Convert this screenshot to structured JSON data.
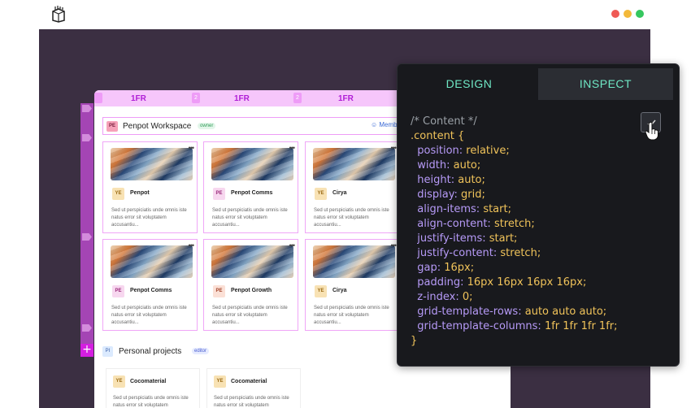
{
  "window": {
    "logo_icon": "box-logo-icon",
    "dots": [
      "#ef5a55",
      "#f3b93a",
      "#36c75f"
    ]
  },
  "colruler": {
    "tracks": [
      "1FR",
      "1FR",
      "1FR"
    ],
    "gaps": [
      "2",
      "2",
      "2"
    ]
  },
  "workspace": {
    "badge": "PE",
    "title": "Penpot Workspace",
    "role": "owner",
    "members_label": "Memb"
  },
  "projects": [
    {
      "badge": "YE",
      "badge_bg": "#f8e2b4",
      "badge_color": "#9a6a14",
      "name": "Penpot",
      "desc": "Sed ut perspiciatis unde omnis iste natus error sit voluptatem accusantiu..."
    },
    {
      "badge": "PE",
      "badge_bg": "#f7d7ef",
      "badge_color": "#9b2c7c",
      "name": "Penpot Comms",
      "desc": "Sed ut perspiciatis unde omnis iste natus error sit voluptatem accusantiu..."
    },
    {
      "badge": "YE",
      "badge_bg": "#f8e2b4",
      "badge_color": "#9a6a14",
      "name": "Cirya",
      "desc": "Sed ut perspiciatis unde omnis iste natus error sit voluptatem accusantiu..."
    },
    {
      "badge": "PE",
      "badge_bg": "#f7d7ef",
      "badge_color": "#9b2c7c",
      "name": "Penpot Comms",
      "desc": "Sed ut perspiciatis unde omnis iste natus error sit voluptatem accusantiu..."
    },
    {
      "badge": "PE",
      "badge_bg": "#fbe0d6",
      "badge_color": "#a2452b",
      "name": "Penpot Growth",
      "desc": "Sed ut perspiciatis unde omnis iste natus error sit voluptatem accusantiu..."
    },
    {
      "badge": "YE",
      "badge_bg": "#f8e2b4",
      "badge_color": "#9a6a14",
      "name": "Cirya",
      "desc": "Sed ut perspiciatis unde omnis iste natus error sit voluptatem accusantiu..."
    }
  ],
  "personal": {
    "badge": "PI",
    "title": "Personal projects",
    "role": "editor",
    "cards": [
      {
        "badge": "YE",
        "name": "Cocomaterial",
        "desc": "Sed ut perspiciatis unde omnis iste natus error sit voluptatem"
      },
      {
        "badge": "YE",
        "name": "Cocomaterial",
        "desc": "Sed ut perspiciatis unde omnis iste natus error sit voluptatem"
      }
    ]
  },
  "inspect": {
    "tabs": [
      "DESIGN",
      "INSPECT"
    ],
    "active_tab": "INSPECT",
    "code": {
      "comment": "/* Content */",
      "selector": ".content {",
      "declarations": [
        {
          "prop": "position:",
          "val": "relative;"
        },
        {
          "prop": "width:",
          "val": "auto;"
        },
        {
          "prop": "height:",
          "val": "auto;"
        },
        {
          "prop": "display:",
          "val": "grid;"
        },
        {
          "prop": "align-items:",
          "val": "start;"
        },
        {
          "prop": "align-content:",
          "val": "stretch;"
        },
        {
          "prop": "justify-items:",
          "val": "start;"
        },
        {
          "prop": "justify-content:",
          "val": "stretch;"
        },
        {
          "prop": "gap:",
          "val": "16px;"
        },
        {
          "prop": "padding:",
          "val": "16px 16px 16px 16px;"
        },
        {
          "prop": "z-index:",
          "val": "0;"
        },
        {
          "prop": "grid-template-rows:",
          "val": "auto auto auto;"
        },
        {
          "prop": "grid-template-columns:",
          "val": "1fr 1fr 1fr 1fr;"
        }
      ],
      "close": "}"
    },
    "copy_icon": "copy-check-icon",
    "cursor_icon": "hand-pointer-icon"
  }
}
